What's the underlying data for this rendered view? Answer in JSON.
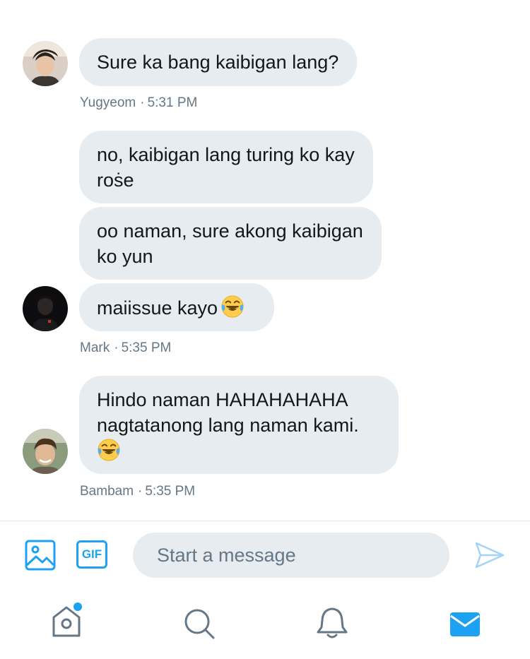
{
  "messages": [
    {
      "sender": "Yugyeom",
      "time": "5:31 PM",
      "bubbles": [
        {
          "lines": [
            "Sure ka bang kaibigan lang?"
          ]
        }
      ]
    },
    {
      "sender": "Mark",
      "time": "5:35 PM",
      "bubbles": [
        {
          "lines": [
            "no, kaibigan lang turing ko kay",
            "roṡe"
          ]
        },
        {
          "lines": [
            "oo naman, sure akong kaibigan",
            "ko yun"
          ]
        },
        {
          "lines": [
            "maiissue kayo"
          ],
          "emoji": "face-with-tears-of-joy"
        }
      ]
    },
    {
      "sender": "Bambam",
      "time": "5:35 PM",
      "bubbles": [
        {
          "lines": [
            "Hindo naman HAHAHAHAHA",
            "nagtatanong lang naman kami."
          ],
          "emoji": "face-with-tears-of-joy"
        }
      ]
    }
  ],
  "meta_separator": "·",
  "composer": {
    "gif_label": "GIF",
    "placeholder": "Start a message",
    "icons": [
      "image-icon",
      "gif-icon",
      "send-icon"
    ]
  },
  "tabbar": {
    "items": [
      {
        "icon": "home-icon",
        "has_notification_dot": true
      },
      {
        "icon": "search-icon",
        "has_notification_dot": false
      },
      {
        "icon": "bell-icon",
        "has_notification_dot": false
      },
      {
        "icon": "mail-icon",
        "active": true
      }
    ]
  },
  "colors": {
    "accent": "#1da1f2",
    "bubble_bg": "#e6ecf0",
    "text_primary": "#14171a",
    "text_secondary": "#657786",
    "icon_inactive": "#657786"
  }
}
